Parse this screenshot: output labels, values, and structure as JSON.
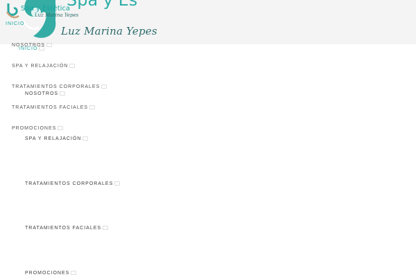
{
  "brand": {
    "title": "Spa y Estética",
    "subtitle": "Luz Marina Yepes"
  },
  "nav_primary": [
    {
      "label": "INICIO"
    },
    {
      "label": "NOSOTROS"
    },
    {
      "label": "SPA Y RELAJACIÓN"
    },
    {
      "label": "TRATAMIENTOS CORPORALES"
    },
    {
      "label": "TRATAMIENTOS FACIALES"
    },
    {
      "label": "PROMOCIONES"
    }
  ],
  "nav_secondary": [
    {
      "label": "INICIO"
    },
    {
      "label": "NOSOTROS"
    },
    {
      "label": "SPA Y RELAJACIÓN"
    },
    {
      "label": "TRATAMIENTOS CORPORALES"
    },
    {
      "label": "TRATAMIENTOS FACIALES"
    },
    {
      "label": "PROMOCIONES"
    }
  ],
  "colors": {
    "accent": "#1aa6a0",
    "header_bg": "#f4f4f4",
    "text": "#555555"
  }
}
